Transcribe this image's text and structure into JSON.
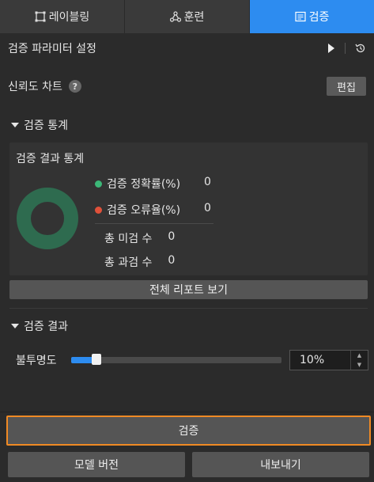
{
  "tabs": [
    {
      "label": "레이블링",
      "icon": "labeling-icon",
      "active": false
    },
    {
      "label": "훈련",
      "icon": "training-icon",
      "active": false
    },
    {
      "label": "검증",
      "icon": "validation-icon",
      "active": true
    }
  ],
  "param_settings": {
    "title": "검증 파라미터 설정",
    "play_icon": "play-icon",
    "history_icon": "history-icon"
  },
  "confidence_chart": {
    "title": "신뢰도 차트",
    "help": "?",
    "edit_label": "편집"
  },
  "stats_section": {
    "title": "검증 통계",
    "panel_title": "검증 결과 통계",
    "accuracy_label": "검증 정확률(%)",
    "accuracy_value": "0",
    "error_label": "검증 오류율(%)",
    "error_value": "0",
    "total_missed_label": "총 미검 수",
    "total_missed_value": "0",
    "total_over_label": "총 과검 수",
    "total_over_value": "0",
    "report_button": "전체 리포트 보기"
  },
  "results_section": {
    "title": "검증 결과",
    "opacity_label": "불투명도",
    "opacity_value": "10%",
    "opacity_fraction": 0.12
  },
  "actions": {
    "verify": "검증",
    "model_version": "모델 버전",
    "export": "내보내기"
  },
  "colors": {
    "accent": "#2d8cf0",
    "highlight_border": "#f08a24",
    "accuracy_dot": "#3cb878",
    "error_dot": "#e0513a",
    "donut": "#2e6b4f"
  }
}
